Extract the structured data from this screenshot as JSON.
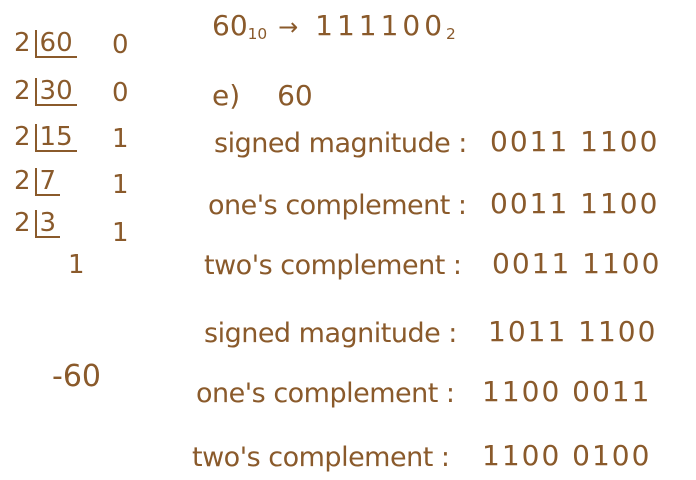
{
  "division": {
    "rows": [
      {
        "divisor": "2",
        "dividend": "60",
        "remainder": "0"
      },
      {
        "divisor": "2",
        "dividend": "30",
        "remainder": "0"
      },
      {
        "divisor": "2",
        "dividend": "15",
        "remainder": "1"
      },
      {
        "divisor": "2",
        "dividend": "7",
        "remainder": "1"
      },
      {
        "divisor": "2",
        "dividend": "3",
        "remainder": "1"
      }
    ],
    "final_quotient": "1"
  },
  "conversion": {
    "decimal": "60",
    "decimal_base": "10",
    "arrow": "→",
    "binary": "111100",
    "binary_base": "2"
  },
  "part_label": "e)",
  "positive_value": "60",
  "negative_value": "-60",
  "positive_section": {
    "signed_label": "signed magnitude :",
    "signed_value": "0011 1100",
    "ones_label": "one's complement :",
    "ones_value": "0011 1100",
    "twos_label": "two's complement :",
    "twos_value": "0011 1100"
  },
  "negative_section": {
    "signed_label": "signed magnitude :",
    "signed_value": "1011 1100",
    "ones_label": "one's complement :",
    "ones_value": "1100 0011",
    "twos_label": "two's complement :",
    "twos_value": "1100 0100"
  },
  "ink_color": "#8a5a2b"
}
